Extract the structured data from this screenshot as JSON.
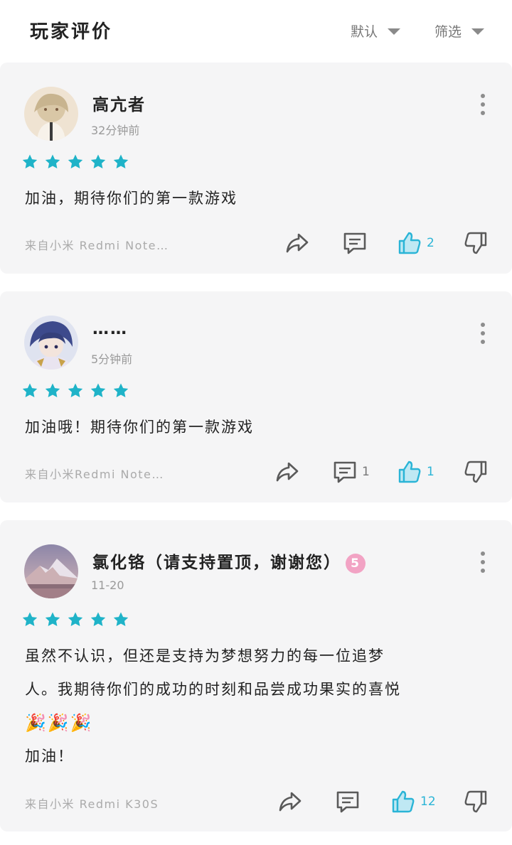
{
  "header": {
    "title": "玩家评价",
    "sort_label": "默认",
    "filter_label": "筛选"
  },
  "colors": {
    "star": "#1fb3c8",
    "like_active": "#2ab4d6",
    "card_bg": "#f5f5f6",
    "badge": "#f2a3c4"
  },
  "reviews": [
    {
      "author": "高亢者",
      "time": "32分钟前",
      "rating": 5,
      "text": "加油，期待你们的第一款游戏",
      "device": "来自小米 Redmi Note…",
      "reply_count": "",
      "like_count": "2",
      "avatar_icon": "avatar-blond-anime"
    },
    {
      "author": "……",
      "time": "5分钟前",
      "rating": 5,
      "text": "加油哦！期待你们的第一款游戏",
      "device": "来自小米Redmi Note…",
      "reply_count": "1",
      "like_count": "1",
      "avatar_icon": "avatar-blue-hair-anime"
    },
    {
      "author": "氯化铬（请支持置顶，谢谢您）",
      "badge": "5",
      "time": "11-20",
      "rating": 5,
      "text_lines": [
        "虽然不认识，但还是支持为梦想努力的每一位追梦",
        "人。我期待你们的成功的时刻和品尝成功果实的喜悦"
      ],
      "emoji_line": "🎉🎉🎉",
      "text_last": "加油！",
      "device": "来自小米 Redmi K30S",
      "reply_count": "",
      "like_count": "12",
      "avatar_icon": "avatar-mountain-landscape"
    }
  ]
}
